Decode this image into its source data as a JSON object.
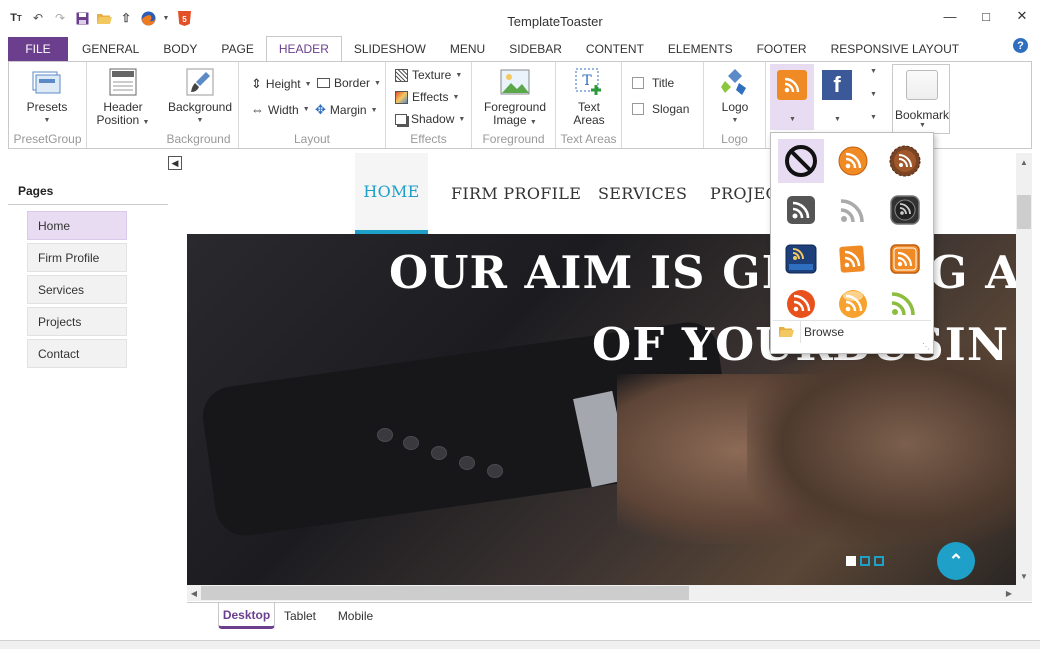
{
  "app": {
    "title": "TemplateToaster"
  },
  "ribbon_tabs": [
    "FILE",
    "GENERAL",
    "BODY",
    "PAGE",
    "HEADER",
    "SLIDESHOW",
    "MENU",
    "SIDEBAR",
    "CONTENT",
    "ELEMENTS",
    "FOOTER",
    "RESPONSIVE LAYOUT"
  ],
  "ribbon": {
    "presets": "Presets",
    "presetgroup": "PresetGroup",
    "header_position_1": "Header",
    "header_position_2": "Position",
    "background": "Background",
    "background_group": "Background",
    "height": "Height",
    "width": "Width",
    "border": "Border",
    "margin": "Margin",
    "layout_group": "Layout",
    "texture": "Texture",
    "effects": "Effects",
    "shadow": "Shadow",
    "effects_group": "Effects",
    "foreground_image_1": "Foreground",
    "foreground_image_2": "Image",
    "foreground_group": "Foreground",
    "text_areas_1": "Text",
    "text_areas_2": "Areas",
    "text_areas_group": "Text Areas",
    "title_chk": "Title",
    "slogan_chk": "Slogan",
    "logo": "Logo",
    "logo_group": "Logo",
    "bookmark": "Bookmark"
  },
  "pages_panel": {
    "title": "Pages",
    "items": [
      "Home",
      "Firm Profile",
      "Services",
      "Projects",
      "Contact"
    ]
  },
  "preview": {
    "nav": [
      "HOME",
      "FIRM PROFILE",
      "SERVICES",
      "PROJEC"
    ],
    "hero_line1": "OUR AIM IS GE",
    "hero_line1b": "NG A",
    "hero_line2": "OF YOUR",
    "hero_line2b": "BUSIN"
  },
  "popup": {
    "browse": "Browse"
  },
  "device_tabs": [
    "Desktop",
    "Tablet",
    "Mobile"
  ],
  "colors": {
    "accent_purple": "#6b3f8e",
    "accent_cyan": "#1ea0c8",
    "rss_orange": "#f08a24"
  }
}
